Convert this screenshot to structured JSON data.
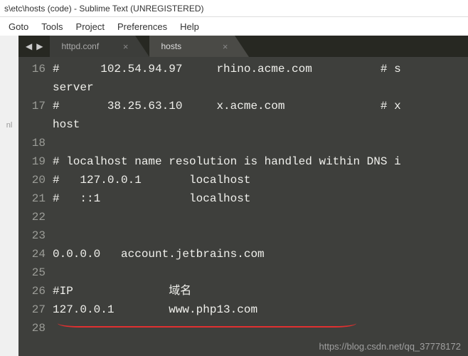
{
  "window": {
    "title": "s\\etc\\hosts (code) - Sublime Text (UNREGISTERED)"
  },
  "menu": {
    "items": [
      "Goto",
      "Tools",
      "Project",
      "Preferences",
      "Help"
    ]
  },
  "left_label": "nl",
  "tabs": {
    "inactive": "httpd.conf",
    "active": "hosts"
  },
  "lines": [
    {
      "num": "16",
      "text": "#      102.54.94.97     rhino.acme.com          # s"
    },
    {
      "num": "",
      "text": "server"
    },
    {
      "num": "17",
      "text": "#       38.25.63.10     x.acme.com              # x"
    },
    {
      "num": "",
      "text": "host"
    },
    {
      "num": "18",
      "text": ""
    },
    {
      "num": "19",
      "text": "# localhost name resolution is handled within DNS i"
    },
    {
      "num": "20",
      "text": "#   127.0.0.1       localhost"
    },
    {
      "num": "21",
      "text": "#   ::1             localhost"
    },
    {
      "num": "22",
      "text": ""
    },
    {
      "num": "23",
      "text": ""
    },
    {
      "num": "24",
      "text": "0.0.0.0   account.jetbrains.com"
    },
    {
      "num": "25",
      "text": ""
    },
    {
      "num": "26",
      "text": "#IP              域名"
    },
    {
      "num": "27",
      "text": "127.0.0.1        www.php13.com"
    },
    {
      "num": "28",
      "text": ""
    }
  ],
  "watermark": "https://blog.csdn.net/qq_37778172"
}
